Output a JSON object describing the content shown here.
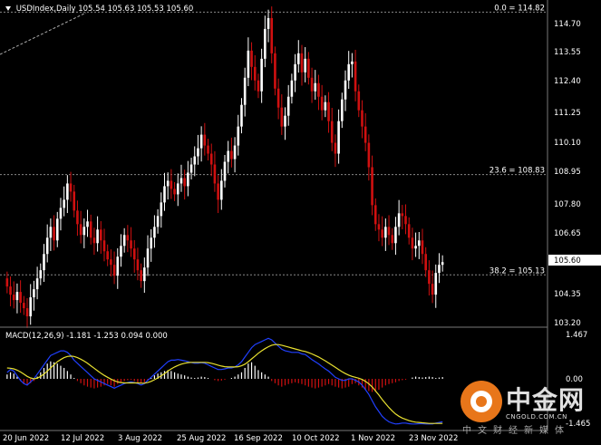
{
  "header": {
    "symbol_label": "USDIndex,Daily",
    "ohlc": "105.54 105.63 105.53 105.60"
  },
  "macd_header": {
    "label": "MACD(12,26,9) -1.181 -1.253 0.094 0.000"
  },
  "price_axis": {
    "ticks": [
      "114.70",
      "113.55",
      "112.40",
      "111.25",
      "110.10",
      "108.95",
      "107.80",
      "106.65",
      "105.60",
      "104.35",
      "103.20"
    ],
    "current_price": "105.60"
  },
  "macd_axis": {
    "ticks": [
      "1.467",
      "0.00",
      "-1.465"
    ]
  },
  "date_axis": {
    "ticks": [
      "20 Jun 2022",
      "12 Jul 2022",
      "3 Aug 2022",
      "25 Aug 2022",
      "16 Sep 2022",
      "10 Oct 2022",
      "1 Nov 2022",
      "23 Nov 2022"
    ]
  },
  "fib_levels": [
    {
      "label": "0.0 = 114.82",
      "value": 114.82
    },
    {
      "label": "23.6 = 108.83",
      "value": 108.83
    },
    {
      "label": "38.2 = 105.13",
      "value": 105.13
    }
  ],
  "watermark": {
    "brand_cn": "中金网",
    "brand_en": "CNGOLD.COM.CN",
    "tagline": "中文财经新媒体"
  },
  "colors": {
    "background": "#000000",
    "bull_candle": "#ffffff",
    "bear_candle": "#d01010",
    "macd_line": "#2040ff",
    "signal_line": "#e8e030",
    "hist_pos": "#ffffff",
    "hist_neg": "#d01010",
    "fib": "#888888",
    "accent": "#e8761a"
  },
  "chart_data": {
    "type": "candlestick",
    "title": "USDIndex,Daily",
    "closes": [
      104.7,
      104.4,
      104.2,
      104.5,
      104.1,
      103.9,
      103.6,
      104.3,
      104.6,
      105.0,
      105.3,
      105.9,
      106.5,
      106.9,
      106.4,
      107.2,
      107.6,
      107.9,
      108.5,
      108.2,
      107.5,
      107.0,
      106.6,
      106.9,
      107.1,
      106.5,
      106.3,
      106.8,
      106.4,
      106.0,
      105.7,
      105.5,
      105.1,
      105.8,
      106.2,
      106.6,
      106.4,
      106.1,
      105.7,
      105.3,
      104.9,
      105.4,
      106.1,
      106.5,
      106.9,
      107.3,
      107.8,
      108.4,
      108.6,
      108.3,
      108.1,
      108.5,
      108.7,
      108.4,
      108.9,
      109.2,
      109.5,
      109.8,
      110.3,
      109.9,
      109.6,
      109.2,
      108.5,
      107.9,
      108.6,
      109.3,
      109.7,
      109.4,
      109.9,
      110.6,
      111.4,
      112.4,
      113.4,
      112.8,
      112.3,
      111.9,
      113.1,
      114.2,
      114.6,
      113.3,
      112.0,
      111.3,
      110.6,
      111.0,
      111.7,
      112.3,
      112.9,
      113.3,
      112.6,
      113.1,
      112.4,
      111.9,
      112.2,
      111.7,
      111.2,
      111.5,
      110.8,
      110.0,
      109.6,
      110.8,
      111.6,
      112.3,
      112.9,
      113.0,
      111.9,
      111.2,
      110.6,
      110.0,
      109.1,
      107.7,
      107.0,
      106.8,
      106.5,
      106.9,
      106.6,
      106.3,
      106.9,
      107.4,
      107.3,
      107.0,
      106.5,
      106.1,
      106.2,
      106.4,
      105.9,
      105.3,
      104.8,
      104.4,
      105.2,
      105.5,
      105.6
    ],
    "macd": [
      0.2,
      0.3,
      0.25,
      0.1,
      -0.05,
      -0.15,
      -0.2,
      -0.1,
      0.0,
      0.15,
      0.3,
      0.45,
      0.6,
      0.75,
      0.8,
      0.85,
      0.9,
      0.9,
      0.85,
      0.75,
      0.6,
      0.5,
      0.4,
      0.3,
      0.2,
      0.1,
      0.0,
      -0.05,
      -0.1,
      -0.15,
      -0.2,
      -0.25,
      -0.3,
      -0.25,
      -0.2,
      -0.15,
      -0.12,
      -0.1,
      -0.12,
      -0.15,
      -0.2,
      -0.15,
      -0.05,
      0.05,
      0.15,
      0.25,
      0.35,
      0.45,
      0.55,
      0.6,
      0.6,
      0.62,
      0.6,
      0.58,
      0.55,
      0.52,
      0.5,
      0.5,
      0.52,
      0.5,
      0.45,
      0.4,
      0.35,
      0.3,
      0.3,
      0.32,
      0.35,
      0.35,
      0.38,
      0.45,
      0.55,
      0.7,
      0.85,
      1.0,
      1.1,
      1.15,
      1.2,
      1.25,
      1.3,
      1.25,
      1.15,
      1.05,
      0.95,
      0.9,
      0.88,
      0.85,
      0.85,
      0.85,
      0.8,
      0.78,
      0.7,
      0.62,
      0.55,
      0.48,
      0.4,
      0.32,
      0.25,
      0.15,
      0.05,
      0.0,
      -0.05,
      -0.05,
      0.0,
      0.0,
      -0.05,
      -0.1,
      -0.2,
      -0.35,
      -0.5,
      -0.7,
      -0.9,
      -1.05,
      -1.2,
      -1.3,
      -1.38,
      -1.42,
      -1.45,
      -1.44,
      -1.42,
      -1.42,
      -1.44,
      -1.45,
      -1.45,
      -1.44,
      -1.44,
      -1.45,
      -1.45,
      -1.45,
      -1.42,
      -1.4,
      -1.38
    ],
    "signal": [
      0.35,
      0.34,
      0.32,
      0.28,
      0.22,
      0.15,
      0.08,
      0.03,
      0.0,
      0.02,
      0.08,
      0.15,
      0.25,
      0.35,
      0.45,
      0.55,
      0.62,
      0.68,
      0.72,
      0.73,
      0.72,
      0.68,
      0.63,
      0.57,
      0.5,
      0.42,
      0.34,
      0.26,
      0.18,
      0.11,
      0.05,
      -0.01,
      -0.06,
      -0.1,
      -0.12,
      -0.13,
      -0.13,
      -0.13,
      -0.13,
      -0.13,
      -0.14,
      -0.14,
      -0.12,
      -0.08,
      -0.03,
      0.03,
      0.1,
      0.17,
      0.25,
      0.32,
      0.38,
      0.43,
      0.47,
      0.5,
      0.52,
      0.53,
      0.53,
      0.53,
      0.53,
      0.53,
      0.52,
      0.5,
      0.47,
      0.44,
      0.41,
      0.39,
      0.38,
      0.38,
      0.38,
      0.39,
      0.42,
      0.47,
      0.55,
      0.64,
      0.73,
      0.82,
      0.9,
      0.97,
      1.03,
      1.08,
      1.1,
      1.1,
      1.08,
      1.05,
      1.02,
      0.99,
      0.96,
      0.93,
      0.9,
      0.88,
      0.84,
      0.8,
      0.75,
      0.7,
      0.64,
      0.58,
      0.51,
      0.44,
      0.37,
      0.3,
      0.23,
      0.17,
      0.12,
      0.08,
      0.05,
      0.02,
      -0.02,
      -0.08,
      -0.16,
      -0.26,
      -0.39,
      -0.52,
      -0.66,
      -0.79,
      -0.92,
      -1.03,
      -1.13,
      -1.2,
      -1.26,
      -1.3,
      -1.34,
      -1.37,
      -1.39,
      -1.4,
      -1.41,
      -1.42,
      -1.43,
      -1.43,
      -1.43,
      -1.43,
      -1.43
    ],
    "hist": [
      0.1,
      0.15,
      0.12,
      0.05,
      -0.05,
      -0.12,
      -0.15,
      -0.1,
      -0.05,
      0.05,
      0.15,
      0.25,
      0.35,
      0.4,
      0.38,
      0.35,
      0.3,
      0.25,
      0.18,
      0.1,
      0.02,
      -0.05,
      -0.1,
      -0.15,
      -0.18,
      -0.2,
      -0.22,
      -0.2,
      -0.18,
      -0.15,
      -0.12,
      -0.15,
      -0.18,
      -0.12,
      -0.08,
      -0.05,
      -0.03,
      -0.02,
      -0.05,
      -0.08,
      -0.1,
      -0.08,
      -0.04,
      0.02,
      0.08,
      0.12,
      0.15,
      0.18,
      0.2,
      0.18,
      0.15,
      0.12,
      0.1,
      0.08,
      0.05,
      0.03,
      0.02,
      0.03,
      0.05,
      0.04,
      0.02,
      0.0,
      -0.03,
      -0.05,
      -0.04,
      -0.02,
      0.0,
      0.02,
      0.05,
      0.1,
      0.15,
      0.25,
      0.35,
      0.38,
      0.3,
      0.2,
      0.15,
      0.1,
      0.05,
      -0.05,
      -0.1,
      -0.15,
      -0.18,
      -0.15,
      -0.12,
      -0.1,
      -0.08,
      -0.1,
      -0.12,
      -0.15,
      -0.18,
      -0.2,
      -0.22,
      -0.2,
      -0.18,
      -0.15,
      -0.12,
      -0.15,
      -0.18,
      -0.2,
      -0.22,
      -0.2,
      -0.18,
      -0.12,
      -0.1,
      -0.15,
      -0.2,
      -0.25,
      -0.28,
      -0.3,
      -0.3,
      -0.25,
      -0.2,
      -0.15,
      -0.12,
      -0.1,
      -0.08,
      -0.05,
      -0.03,
      -0.02,
      0.0,
      0.03,
      0.05,
      0.04,
      0.03,
      0.04,
      0.05,
      0.04,
      0.02,
      0.03,
      0.04
    ],
    "price_range": [
      103.2,
      115.0
    ],
    "macd_range": [
      -1.6,
      1.6
    ],
    "x_labels": [
      "20 Jun 2022",
      "12 Jul 2022",
      "3 Aug 2022",
      "25 Aug 2022",
      "16 Sep 2022",
      "10 Oct 2022",
      "1 Nov 2022",
      "23 Nov 2022"
    ],
    "y_ticks": [
      114.7,
      113.55,
      112.4,
      111.25,
      110.1,
      108.95,
      107.8,
      106.65,
      104.35,
      103.2
    ]
  }
}
